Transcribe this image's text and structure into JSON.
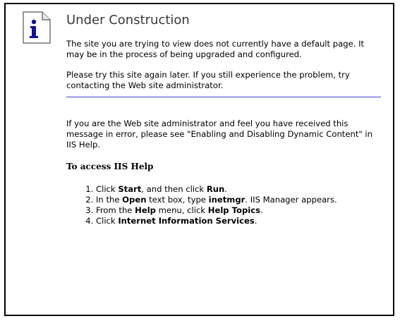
{
  "title": "Under Construction",
  "icon": "info-icon",
  "paragraph1": "The site you are trying to view does not currently have a default page. It may be in the process of being upgraded and configured.",
  "paragraph2": "Please try this site again later. If you still experience the problem, try contacting the Web site administrator.",
  "paragraph3": "If you are the Web site administrator and feel you have received this message in error, please see \"Enabling and Disabling Dynamic Content\" in IIS Help.",
  "help_heading": "To access IIS Help",
  "steps": [
    {
      "pre": "Click ",
      "b1": "Start",
      "mid": ", and then click ",
      "b2": "Run",
      "post": "."
    },
    {
      "pre": "In the ",
      "b1": "Open",
      "mid": " text box, type ",
      "b2": "inetmgr",
      "post": ". IIS Manager appears."
    },
    {
      "pre": "From the ",
      "b1": "Help",
      "mid": " menu, click ",
      "b2": "Help Topics",
      "post": "."
    },
    {
      "pre": "Click ",
      "b1": "Internet Information Services",
      "mid": "",
      "b2": "",
      "post": "."
    }
  ],
  "colors": {
    "divider": "#4444cc",
    "icon_i": "#1010a0",
    "border": "#000000"
  }
}
